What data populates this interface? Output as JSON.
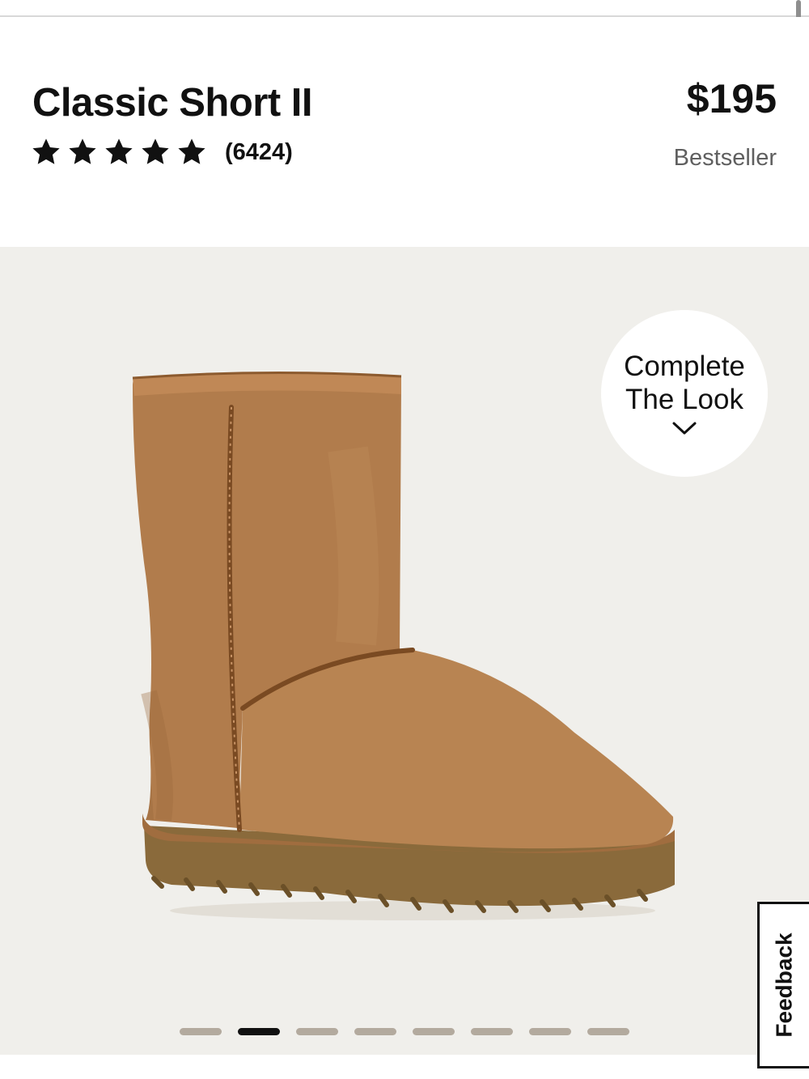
{
  "product": {
    "title": "Classic Short II",
    "rating": 5,
    "rating_max": 5,
    "review_count": "(6424)",
    "price": "$195",
    "badge": "Bestseller"
  },
  "gallery": {
    "image_description": "Chestnut suede short boot with sheepskin trim",
    "complete_the_look": {
      "line1": "Complete",
      "line2": "The Look",
      "icon": "chevron-down-icon"
    },
    "slide_count": 8,
    "active_slide": 2
  },
  "feedback": {
    "label": "Feedback"
  },
  "colors": {
    "gallery_bg": "#f0efeb",
    "dot_inactive": "#b3aa9e",
    "dot_active": "#111111",
    "boot_suede": "#b17c4c",
    "boot_sole": "#8a6a3b",
    "badge_text": "#5f5f5f"
  }
}
